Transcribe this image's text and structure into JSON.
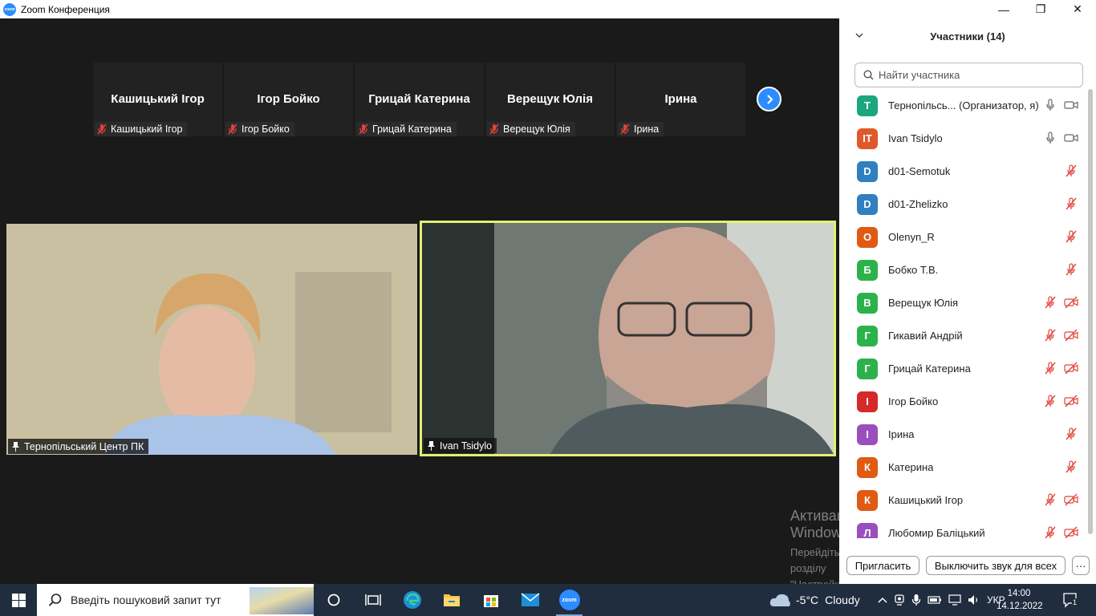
{
  "window": {
    "title": "Zoom Конференция",
    "app_icon_text": "zoom",
    "minimize": "—",
    "maximize": "❐",
    "close": "✕"
  },
  "thumbnails": [
    {
      "name": "Кашицький Ігор",
      "label": "Кашицький Ігор"
    },
    {
      "name": "Ігор Бойко",
      "label": "Ігор Бойко"
    },
    {
      "name": "Грицай Катерина",
      "label": "Грицай Катерина"
    },
    {
      "name": "Верещук Юлія",
      "label": "Верещук Юлія"
    },
    {
      "name": "Ірина",
      "label": "Ірина"
    }
  ],
  "videos": [
    {
      "label": "Тернопільський Центр ПК"
    },
    {
      "label": "Ivan Tsidylo"
    }
  ],
  "panel": {
    "title": "Участники (14)",
    "search_placeholder": "Найти участника",
    "invite_button": "Пригласить",
    "mute_all_button": "Выключить звук для всех",
    "more_button": "···"
  },
  "participants": [
    {
      "initial": "Т",
      "color": "#1ba67e",
      "name": "Тернопільсь...  (Организатор, я)",
      "mic": "on",
      "video": "on"
    },
    {
      "initial": "IT",
      "color": "#e0592a",
      "name": "Ivan Tsidylo",
      "mic": "on",
      "video": "on"
    },
    {
      "initial": "D",
      "color": "#2f7fc1",
      "name": "d01-Semotuk",
      "mic": "off",
      "video": "none"
    },
    {
      "initial": "D",
      "color": "#2f7fc1",
      "name": "d01-Zhelizko",
      "mic": "off",
      "video": "none"
    },
    {
      "initial": "O",
      "color": "#e05a12",
      "name": "Olenyn_R",
      "mic": "off",
      "video": "none"
    },
    {
      "initial": "Б",
      "color": "#2db24b",
      "name": "Бобко Т.В.",
      "mic": "off",
      "video": "none"
    },
    {
      "initial": "В",
      "color": "#2db24b",
      "name": "Верещук Юлія",
      "mic": "off",
      "video": "off"
    },
    {
      "initial": "Г",
      "color": "#2db24b",
      "name": "Гикавий Андрій",
      "mic": "off",
      "video": "off"
    },
    {
      "initial": "Г",
      "color": "#2db24b",
      "name": "Грицай Катерина",
      "mic": "off",
      "video": "off"
    },
    {
      "initial": "І",
      "color": "#d42a2a",
      "name": "Ігор Бойко",
      "mic": "off",
      "video": "off"
    },
    {
      "initial": "І",
      "color": "#9b4fbf",
      "name": "Ірина",
      "mic": "off",
      "video": "none"
    },
    {
      "initial": "К",
      "color": "#e05a12",
      "name": "Катерина",
      "mic": "off",
      "video": "none"
    },
    {
      "initial": "К",
      "color": "#e05a12",
      "name": "Кашицький Ігор",
      "mic": "off",
      "video": "off"
    },
    {
      "initial": "Л",
      "color": "#9b4fbf",
      "name": "Любомир Баліцький",
      "mic": "off",
      "video": "off"
    }
  ],
  "watermark": {
    "line1": "Активація Windows",
    "line2": "Перейдіть до розділу \"Настройки\", щоб",
    "line3": "активувати Windows."
  },
  "taskbar": {
    "search_text": "Введіть пошуковий запит тут",
    "weather_temp": "-5°C",
    "weather_desc": "Cloudy",
    "language": "УКР",
    "time": "14:00",
    "date": "14.12.2022",
    "notifications_count": "1",
    "zoom_icon_text": "zoom"
  }
}
